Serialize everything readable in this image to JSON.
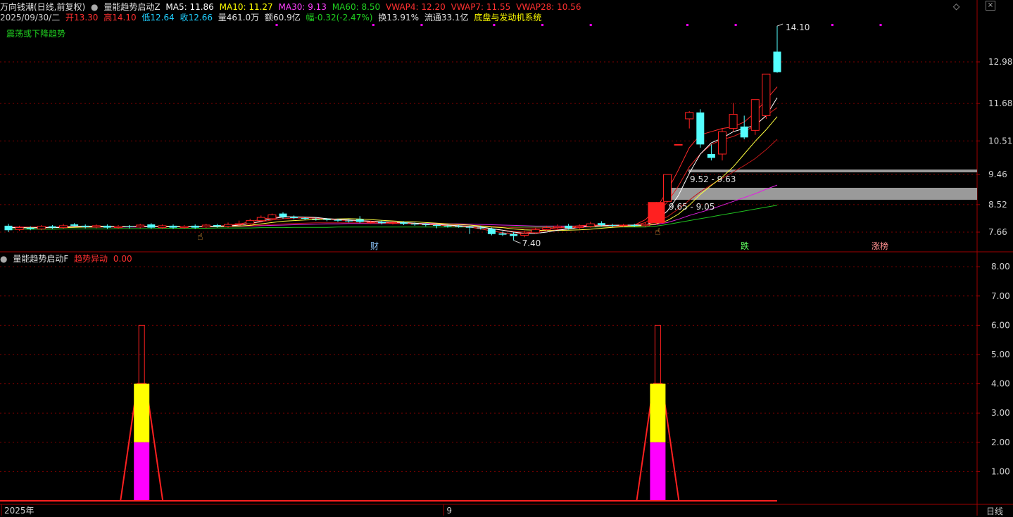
{
  "header": {
    "stock_name": "万向钱潮(日线,前复权)",
    "indicator_name": "量能趋势启动Z",
    "ma5": "MA5: 11.86",
    "ma10": "MA10: 11.27",
    "ma30": "MA30: 9.13",
    "ma60": "MA60: 8.50",
    "vwap4": "VWAP4: 12.20",
    "vwap7": "VWAP7: 11.55",
    "vwap28": "VWAP28: 10.56",
    "date": "2025/09/30/二",
    "open": "开13.30",
    "high": "高14.10",
    "low": "低12.64",
    "close": "收12.66",
    "volume": "量461.0万",
    "amount": "额60.9亿",
    "change": "幅-0.32(-2.47%)",
    "turnover": "换13.91%",
    "float_value": "流通33.1亿",
    "system_name": "底盘与发动机系统",
    "trend_label": "震荡或下降趋势",
    "sub_indicator_name": "量能趋势启动F",
    "sub_signal_label": "趋势异动",
    "sub_signal_value": "0.00",
    "period": "日线"
  },
  "colors": {
    "bg": "#000000",
    "up": "#ff2020",
    "down": "#54ffff",
    "ma5": "#ffffff",
    "ma10": "#ffff00",
    "ma30": "#ff00ff",
    "ma60": "#00c000",
    "vwap": "#e02020",
    "grid": "#800000",
    "axis_text": "#d0d0d0",
    "zone": "#9a9a9a",
    "magenta_bar": "#ff00ff",
    "yellow_bar": "#ffff00"
  },
  "chart_data": [
    {
      "type": "candlestick",
      "title": "万向钱潮(日线,前复权)",
      "y_ticks": [
        7.66,
        8.52,
        9.46,
        10.51,
        11.68,
        12.98
      ],
      "ylim": [
        7.1,
        14.4
      ],
      "annotations": {
        "high_label": "14.10",
        "low_label": "7.40",
        "zone_upper_label": "9.52 - 9.63",
        "zone_lower_label": "9.65 - 9.05",
        "event_tags": [
          "财",
          "跌",
          "涨榜"
        ]
      },
      "candles": [
        {
          "o": 7.86,
          "c": 7.72,
          "h": 7.92,
          "l": 7.66
        },
        {
          "o": 7.74,
          "c": 7.8,
          "h": 7.86,
          "l": 7.7
        },
        {
          "o": 7.8,
          "c": 7.76,
          "h": 7.84,
          "l": 7.72
        },
        {
          "o": 7.76,
          "c": 7.84,
          "h": 7.88,
          "l": 7.72
        },
        {
          "o": 7.84,
          "c": 7.8,
          "h": 7.88,
          "l": 7.76
        },
        {
          "o": 7.8,
          "c": 7.86,
          "h": 7.92,
          "l": 7.76
        },
        {
          "o": 7.9,
          "c": 7.86,
          "h": 7.94,
          "l": 7.82
        },
        {
          "o": 7.86,
          "c": 7.82,
          "h": 7.9,
          "l": 7.78
        },
        {
          "o": 7.82,
          "c": 7.86,
          "h": 7.9,
          "l": 7.78
        },
        {
          "o": 7.86,
          "c": 7.8,
          "h": 7.9,
          "l": 7.76
        },
        {
          "o": 7.8,
          "c": 7.84,
          "h": 7.88,
          "l": 7.76
        },
        {
          "o": 7.84,
          "c": 7.82,
          "h": 7.88,
          "l": 7.78
        },
        {
          "o": 7.82,
          "c": 7.88,
          "h": 7.92,
          "l": 7.78
        },
        {
          "o": 7.9,
          "c": 7.8,
          "h": 7.94,
          "l": 7.76
        },
        {
          "o": 7.8,
          "c": 7.86,
          "h": 7.9,
          "l": 7.76
        },
        {
          "o": 7.86,
          "c": 7.8,
          "h": 7.9,
          "l": 7.76
        },
        {
          "o": 7.8,
          "c": 7.84,
          "h": 7.88,
          "l": 7.76
        },
        {
          "o": 7.86,
          "c": 7.8,
          "h": 7.9,
          "l": 7.76
        },
        {
          "o": 7.82,
          "c": 7.88,
          "h": 7.92,
          "l": 7.78
        },
        {
          "o": 7.88,
          "c": 7.84,
          "h": 7.92,
          "l": 7.8
        },
        {
          "o": 7.84,
          "c": 7.9,
          "h": 7.96,
          "l": 7.8
        },
        {
          "o": 7.9,
          "c": 7.92,
          "h": 8.02,
          "l": 7.86
        },
        {
          "o": 7.92,
          "c": 8.02,
          "h": 8.08,
          "l": 7.88
        },
        {
          "o": 8.02,
          "c": 8.12,
          "h": 8.18,
          "l": 7.96
        },
        {
          "o": 8.08,
          "c": 8.2,
          "h": 8.24,
          "l": 8.04
        },
        {
          "o": 8.24,
          "c": 8.14,
          "h": 8.28,
          "l": 8.08
        },
        {
          "o": 8.14,
          "c": 8.1,
          "h": 8.18,
          "l": 8.06
        },
        {
          "o": 8.1,
          "c": 8.08,
          "h": 8.14,
          "l": 8.04
        },
        {
          "o": 8.08,
          "c": 8.06,
          "h": 8.12,
          "l": 8.02
        },
        {
          "o": 8.06,
          "c": 8.04,
          "h": 8.1,
          "l": 8.0
        },
        {
          "o": 8.04,
          "c": 8.02,
          "h": 8.08,
          "l": 7.98
        },
        {
          "o": 8.02,
          "c": 8.0,
          "h": 8.06,
          "l": 7.96
        },
        {
          "o": 8.06,
          "c": 7.98,
          "h": 8.16,
          "l": 7.94
        },
        {
          "o": 7.96,
          "c": 7.98,
          "h": 8.02,
          "l": 7.92
        },
        {
          "o": 7.98,
          "c": 7.94,
          "h": 8.02,
          "l": 7.9
        },
        {
          "o": 7.94,
          "c": 7.96,
          "h": 8.0,
          "l": 7.9
        },
        {
          "o": 7.96,
          "c": 7.92,
          "h": 8.0,
          "l": 7.88
        },
        {
          "o": 7.92,
          "c": 7.9,
          "h": 7.96,
          "l": 7.86
        },
        {
          "o": 7.9,
          "c": 7.88,
          "h": 7.94,
          "l": 7.84
        },
        {
          "o": 7.88,
          "c": 7.86,
          "h": 7.92,
          "l": 7.78
        },
        {
          "o": 7.86,
          "c": 7.84,
          "h": 7.9,
          "l": 7.8
        },
        {
          "o": 7.84,
          "c": 7.82,
          "h": 7.88,
          "l": 7.8
        },
        {
          "o": 7.82,
          "c": 7.8,
          "h": 7.86,
          "l": 7.6
        },
        {
          "o": 7.8,
          "c": 7.78,
          "h": 7.86,
          "l": 7.74
        },
        {
          "o": 7.76,
          "c": 7.6,
          "h": 7.8,
          "l": 7.56
        },
        {
          "o": 7.62,
          "c": 7.58,
          "h": 7.68,
          "l": 7.54
        },
        {
          "o": 7.6,
          "c": 7.54,
          "h": 7.66,
          "l": 7.4
        },
        {
          "o": 7.56,
          "c": 7.62,
          "h": 7.7,
          "l": 7.5
        },
        {
          "o": 7.64,
          "c": 7.74,
          "h": 7.8,
          "l": 7.6
        },
        {
          "o": 7.74,
          "c": 7.8,
          "h": 7.86,
          "l": 7.7
        },
        {
          "o": 7.8,
          "c": 7.84,
          "h": 7.9,
          "l": 7.76
        },
        {
          "o": 7.86,
          "c": 7.78,
          "h": 7.92,
          "l": 7.74
        },
        {
          "o": 7.8,
          "c": 7.84,
          "h": 7.9,
          "l": 7.76
        },
        {
          "o": 7.84,
          "c": 7.92,
          "h": 7.98,
          "l": 7.8
        },
        {
          "o": 7.94,
          "c": 7.88,
          "h": 8.0,
          "l": 7.84
        },
        {
          "o": 7.88,
          "c": 7.86,
          "h": 7.92,
          "l": 7.82
        },
        {
          "o": 7.86,
          "c": 7.88,
          "h": 7.92,
          "l": 7.82
        },
        {
          "o": 7.88,
          "c": 7.86,
          "h": 7.92,
          "l": 7.82
        },
        {
          "o": 7.86,
          "c": 7.9,
          "h": 7.96,
          "l": 7.82
        },
        {
          "o": 7.94,
          "c": 8.6,
          "h": 8.6,
          "l": 7.9
        },
        {
          "o": 8.62,
          "c": 9.46,
          "h": 9.46,
          "l": 8.6
        },
        {
          "o": 10.4,
          "c": 10.4,
          "h": 10.4,
          "l": 10.4
        },
        {
          "o": 11.2,
          "c": 11.4,
          "h": 11.44,
          "l": 10.9
        },
        {
          "o": 11.4,
          "c": 10.4,
          "h": 11.5,
          "l": 10.3
        },
        {
          "o": 10.1,
          "c": 9.98,
          "h": 10.4,
          "l": 9.9
        },
        {
          "o": 10.1,
          "c": 10.8,
          "h": 10.9,
          "l": 9.9
        },
        {
          "o": 10.9,
          "c": 11.34,
          "h": 11.7,
          "l": 10.8
        },
        {
          "o": 10.96,
          "c": 10.62,
          "h": 11.3,
          "l": 10.56
        },
        {
          "o": 10.84,
          "c": 11.8,
          "h": 11.8,
          "l": 10.7
        },
        {
          "o": 11.3,
          "c": 12.6,
          "h": 12.6,
          "l": 11.2
        },
        {
          "o": 13.3,
          "c": 12.66,
          "h": 14.1,
          "l": 12.64
        }
      ],
      "ma5": [
        7.8,
        7.8,
        7.79,
        7.8,
        7.8,
        7.81,
        7.84,
        7.84,
        7.84,
        7.84,
        7.83,
        7.83,
        7.84,
        7.84,
        7.83,
        7.83,
        7.82,
        7.83,
        7.83,
        7.84,
        7.85,
        7.88,
        7.93,
        8.0,
        8.08,
        8.13,
        8.14,
        8.13,
        8.12,
        8.08,
        8.06,
        8.04,
        8.02,
        8.0,
        7.98,
        7.97,
        7.96,
        7.94,
        7.92,
        7.9,
        7.88,
        7.86,
        7.84,
        7.82,
        7.77,
        7.72,
        7.66,
        7.62,
        7.62,
        7.66,
        7.72,
        7.76,
        7.81,
        7.84,
        7.86,
        7.87,
        7.88,
        7.88,
        7.88,
        8.02,
        8.32,
        8.8,
        9.5,
        10.1,
        10.45,
        10.6,
        10.8,
        10.9,
        11.0,
        11.3,
        11.86
      ],
      "ma10": [
        7.8,
        7.8,
        7.8,
        7.8,
        7.8,
        7.8,
        7.81,
        7.82,
        7.82,
        7.83,
        7.83,
        7.83,
        7.84,
        7.84,
        7.84,
        7.84,
        7.83,
        7.83,
        7.83,
        7.83,
        7.84,
        7.85,
        7.87,
        7.92,
        7.96,
        8.0,
        8.02,
        8.04,
        8.05,
        8.06,
        8.07,
        8.08,
        8.07,
        8.05,
        8.03,
        8.01,
        7.99,
        7.98,
        7.96,
        7.94,
        7.92,
        7.9,
        7.88,
        7.85,
        7.82,
        7.8,
        7.76,
        7.73,
        7.72,
        7.71,
        7.71,
        7.72,
        7.73,
        7.75,
        7.78,
        7.81,
        7.83,
        7.85,
        7.86,
        7.92,
        8.02,
        8.22,
        8.5,
        8.84,
        9.12,
        9.38,
        9.7,
        10.1,
        10.5,
        10.86,
        11.27
      ],
      "ma30": [
        7.82,
        7.82,
        7.82,
        7.82,
        7.82,
        7.82,
        7.82,
        7.82,
        7.82,
        7.82,
        7.82,
        7.82,
        7.82,
        7.83,
        7.83,
        7.83,
        7.83,
        7.83,
        7.83,
        7.83,
        7.84,
        7.84,
        7.85,
        7.86,
        7.87,
        7.88,
        7.89,
        7.9,
        7.91,
        7.92,
        7.92,
        7.93,
        7.93,
        7.93,
        7.93,
        7.93,
        7.93,
        7.93,
        7.93,
        7.93,
        7.92,
        7.92,
        7.91,
        7.9,
        7.89,
        7.88,
        7.87,
        7.86,
        7.85,
        7.85,
        7.85,
        7.85,
        7.85,
        7.85,
        7.85,
        7.85,
        7.86,
        7.86,
        7.87,
        7.9,
        7.96,
        8.06,
        8.18,
        8.28,
        8.38,
        8.5,
        8.62,
        8.74,
        8.86,
        9.0,
        9.13
      ],
      "ma60": [
        7.75,
        7.75,
        7.75,
        7.75,
        7.75,
        7.76,
        7.76,
        7.76,
        7.76,
        7.76,
        7.77,
        7.77,
        7.77,
        7.77,
        7.78,
        7.78,
        7.78,
        7.78,
        7.78,
        7.79,
        7.79,
        7.79,
        7.79,
        7.8,
        7.8,
        7.8,
        7.81,
        7.81,
        7.81,
        7.81,
        7.82,
        7.82,
        7.82,
        7.82,
        7.82,
        7.82,
        7.82,
        7.82,
        7.82,
        7.82,
        7.82,
        7.82,
        7.82,
        7.82,
        7.82,
        7.82,
        7.82,
        7.82,
        7.82,
        7.82,
        7.82,
        7.82,
        7.82,
        7.82,
        7.82,
        7.82,
        7.82,
        7.82,
        7.82,
        7.85,
        7.9,
        7.96,
        8.02,
        8.08,
        8.14,
        8.2,
        8.26,
        8.32,
        8.38,
        8.44,
        8.5
      ],
      "vwap4": [
        7.8,
        7.8,
        7.8,
        7.8,
        7.81,
        7.82,
        7.84,
        7.84,
        7.84,
        7.84,
        7.83,
        7.83,
        7.84,
        7.84,
        7.83,
        7.83,
        7.82,
        7.83,
        7.84,
        7.85,
        7.87,
        7.91,
        7.98,
        8.06,
        8.12,
        8.15,
        8.14,
        8.12,
        8.1,
        8.07,
        8.04,
        8.02,
        8.0,
        7.98,
        7.96,
        7.95,
        7.94,
        7.92,
        7.9,
        7.88,
        7.86,
        7.84,
        7.82,
        7.76,
        7.7,
        7.64,
        7.6,
        7.62,
        7.68,
        7.75,
        7.8,
        7.83,
        7.86,
        7.88,
        7.88,
        7.88,
        7.88,
        7.88,
        8.05,
        8.4,
        8.95,
        9.6,
        10.3,
        10.7,
        10.8,
        10.9,
        10.95,
        11.1,
        11.4,
        11.8,
        12.2
      ],
      "vwap7": [
        7.8,
        7.8,
        7.8,
        7.8,
        7.8,
        7.81,
        7.82,
        7.83,
        7.83,
        7.83,
        7.83,
        7.83,
        7.84,
        7.84,
        7.84,
        7.83,
        7.83,
        7.83,
        7.83,
        7.84,
        7.86,
        7.88,
        7.92,
        7.98,
        8.04,
        8.08,
        8.1,
        8.1,
        8.09,
        8.08,
        8.06,
        8.04,
        8.02,
        8.0,
        7.98,
        7.96,
        7.95,
        7.93,
        7.91,
        7.89,
        7.87,
        7.85,
        7.83,
        7.8,
        7.76,
        7.72,
        7.68,
        7.66,
        7.67,
        7.7,
        7.74,
        7.78,
        7.82,
        7.85,
        7.86,
        7.87,
        7.87,
        7.87,
        7.96,
        8.2,
        8.6,
        9.1,
        9.7,
        10.1,
        10.4,
        10.55,
        10.65,
        10.8,
        11.0,
        11.3,
        11.55
      ],
      "vwap28": [
        7.82,
        7.82,
        7.82,
        7.82,
        7.82,
        7.82,
        7.82,
        7.82,
        7.82,
        7.82,
        7.82,
        7.83,
        7.83,
        7.83,
        7.83,
        7.83,
        7.83,
        7.83,
        7.83,
        7.84,
        7.84,
        7.85,
        7.86,
        7.88,
        7.9,
        7.92,
        7.93,
        7.94,
        7.95,
        7.95,
        7.95,
        7.95,
        7.95,
        7.94,
        7.94,
        7.93,
        7.93,
        7.92,
        7.92,
        7.91,
        7.9,
        7.89,
        7.88,
        7.86,
        7.84,
        7.82,
        7.8,
        7.79,
        7.79,
        7.79,
        7.8,
        7.81,
        7.82,
        7.83,
        7.84,
        7.84,
        7.85,
        7.85,
        7.88,
        7.98,
        8.14,
        8.38,
        8.66,
        8.92,
        9.14,
        9.34,
        9.54,
        9.74,
        9.96,
        10.24,
        10.56
      ]
    },
    {
      "type": "bar",
      "title": "量能趋势启动F",
      "y_ticks": [
        1.0,
        2.0,
        3.0,
        4.0,
        5.0,
        6.0,
        7.0,
        8.0
      ],
      "ylim": [
        0,
        8.4
      ],
      "signals": [
        {
          "index": 12,
          "magenta": 2.0,
          "yellow": 4.0,
          "outline": 6.0
        },
        {
          "index": 59,
          "magenta": 2.0,
          "yellow": 4.0,
          "outline": 6.0
        }
      ]
    }
  ],
  "x_axis": {
    "labels": [
      {
        "text": "2025年",
        "index": 0
      },
      {
        "text": "9",
        "index": 39
      }
    ]
  }
}
